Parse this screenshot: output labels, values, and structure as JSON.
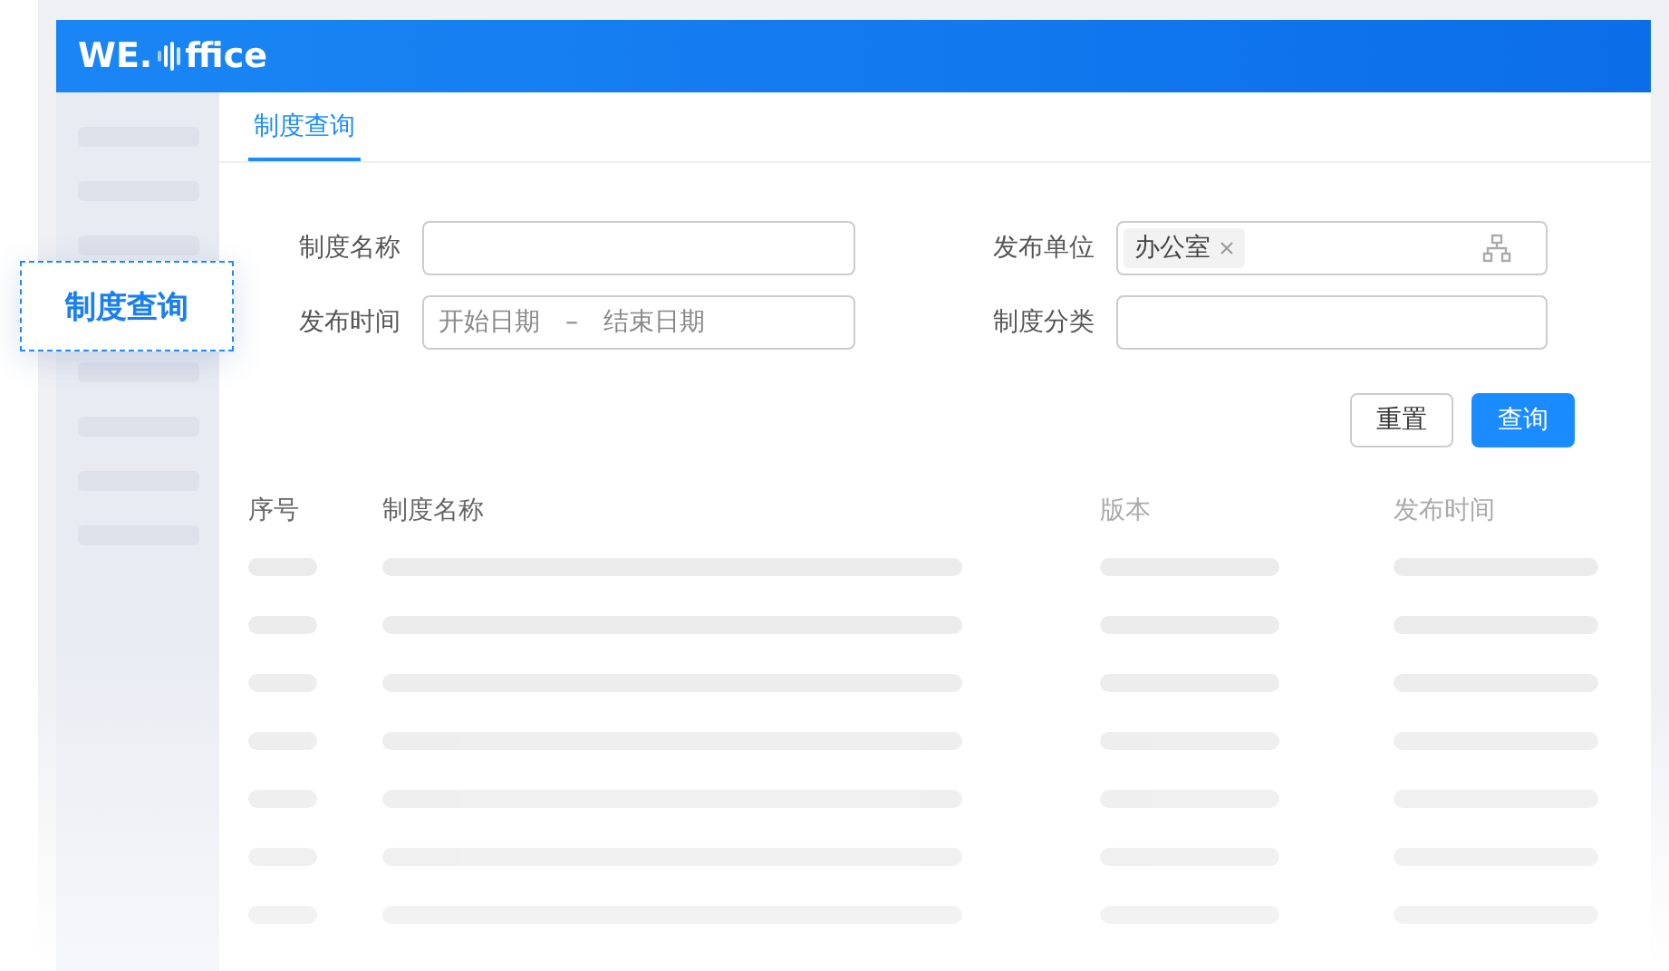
{
  "logo": {
    "prefix": "WE.",
    "suffix": "ffice"
  },
  "tabs": [
    {
      "label": "制度查询",
      "selected": true
    }
  ],
  "form": {
    "name_label": "制度名称",
    "time_label": "发布时间",
    "start_placeholder": "开始日期",
    "separator": "–",
    "end_placeholder": "结束日期",
    "unit_label": "发布单位",
    "unit_tags": [
      "办公室"
    ],
    "category_label": "制度分类"
  },
  "buttons": [
    {
      "label": "重置",
      "kind": "plain"
    },
    {
      "label": "查询",
      "kind": "primary"
    }
  ],
  "table": {
    "columns": [
      "序号",
      "制度名称",
      "版本",
      "发布时间"
    ]
  },
  "callout": {
    "label": "制度查询"
  }
}
